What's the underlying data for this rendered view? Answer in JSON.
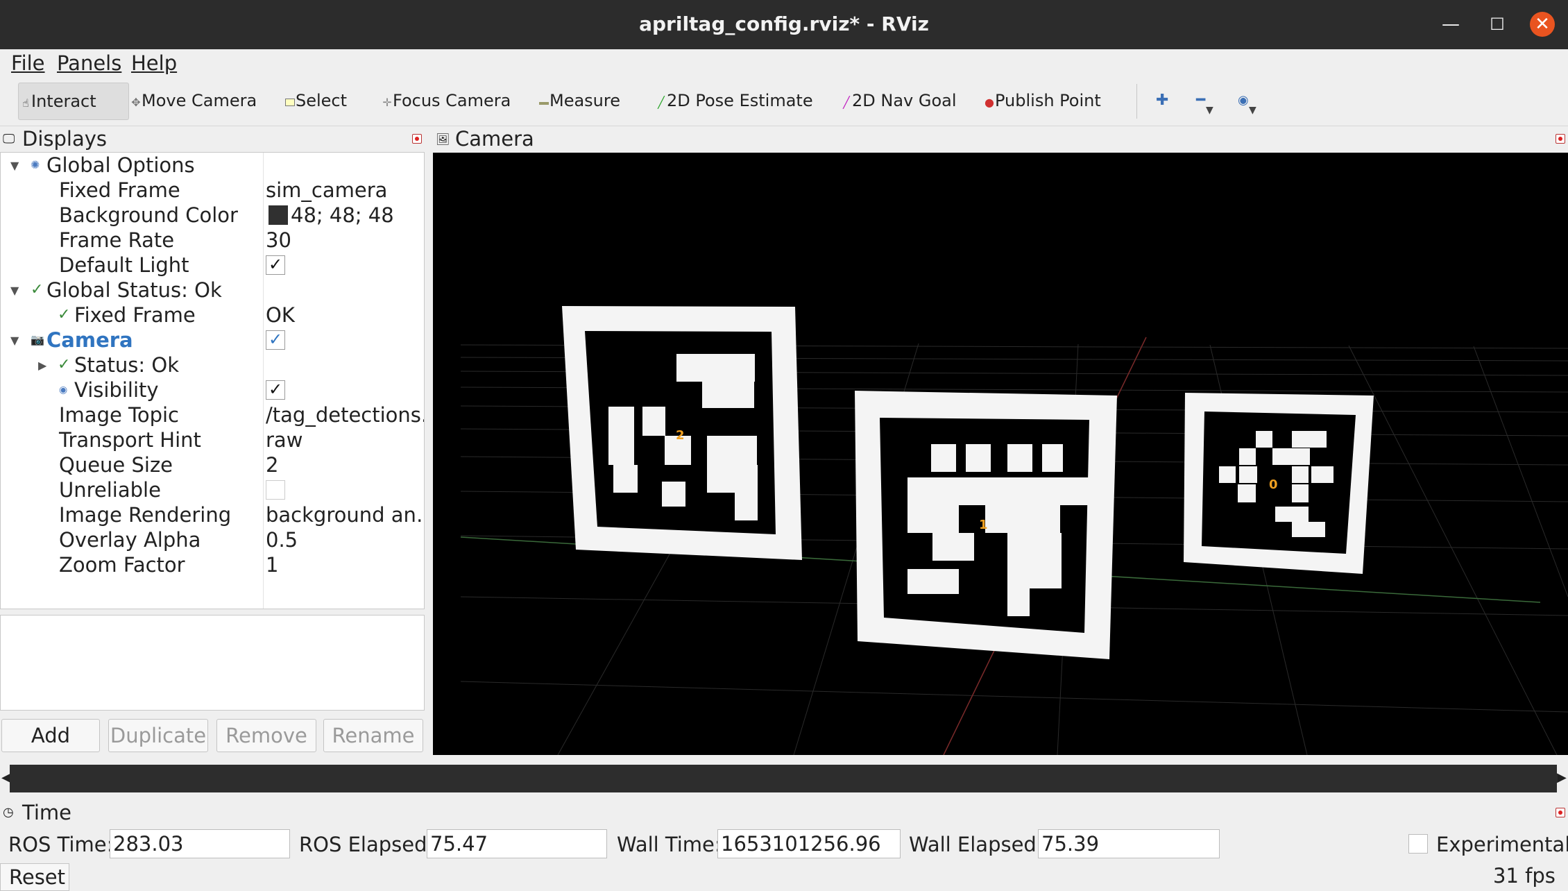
{
  "window": {
    "title": "apriltag_config.rviz* - RViz"
  },
  "menu": {
    "file": "File",
    "panels": "Panels",
    "help": "Help"
  },
  "toolbar": {
    "interact": "Interact",
    "move_camera": "Move Camera",
    "select": "Select",
    "focus_camera": "Focus Camera",
    "measure": "Measure",
    "pose_estimate": "2D Pose Estimate",
    "nav_goal": "2D Nav Goal",
    "publish_point": "Publish Point"
  },
  "displays": {
    "title": "Displays",
    "global_options": "Global Options",
    "fixed_frame_label": "Fixed Frame",
    "fixed_frame_value": "sim_camera",
    "background_color_label": "Background Color",
    "background_color_value": "48; 48; 48",
    "background_color_swatch": "#303030",
    "frame_rate_label": "Frame Rate",
    "frame_rate_value": "30",
    "default_light_label": "Default Light",
    "default_light_checked": true,
    "global_status": "Global Status: Ok",
    "status_fixed_frame_label": "Fixed Frame",
    "status_fixed_frame_value": "OK",
    "camera_label": "Camera",
    "camera_checked": true,
    "status_ok": "Status: Ok",
    "visibility_label": "Visibility",
    "visibility_checked": true,
    "image_topic_label": "Image Topic",
    "image_topic_value": "/tag_detections..",
    "transport_hint_label": "Transport Hint",
    "transport_hint_value": "raw",
    "queue_size_label": "Queue Size",
    "queue_size_value": "2",
    "unreliable_label": "Unreliable",
    "unreliable_checked": false,
    "image_rendering_label": "Image Rendering",
    "image_rendering_value": "background an…",
    "overlay_alpha_label": "Overlay Alpha",
    "overlay_alpha_value": "0.5",
    "zoom_factor_label": "Zoom Factor",
    "zoom_factor_value": "1",
    "buttons": {
      "add": "Add",
      "duplicate": "Duplicate",
      "remove": "Remove",
      "rename": "Rename"
    }
  },
  "camera_panel": {
    "title": "Camera",
    "tag_ids": [
      "2",
      "1",
      "0"
    ]
  },
  "time_panel": {
    "title": "Time",
    "ros_time_label": "ROS Time:",
    "ros_time_value": "283.03",
    "ros_elapsed_label": "ROS Elapsed:",
    "ros_elapsed_value": "75.47",
    "wall_time_label": "Wall Time:",
    "wall_time_value": "1653101256.96",
    "wall_elapsed_label": "Wall Elapsed:",
    "wall_elapsed_value": "75.39",
    "experimental_label": "Experimental",
    "experimental_checked": false,
    "reset": "Reset",
    "fps": "31 fps"
  }
}
